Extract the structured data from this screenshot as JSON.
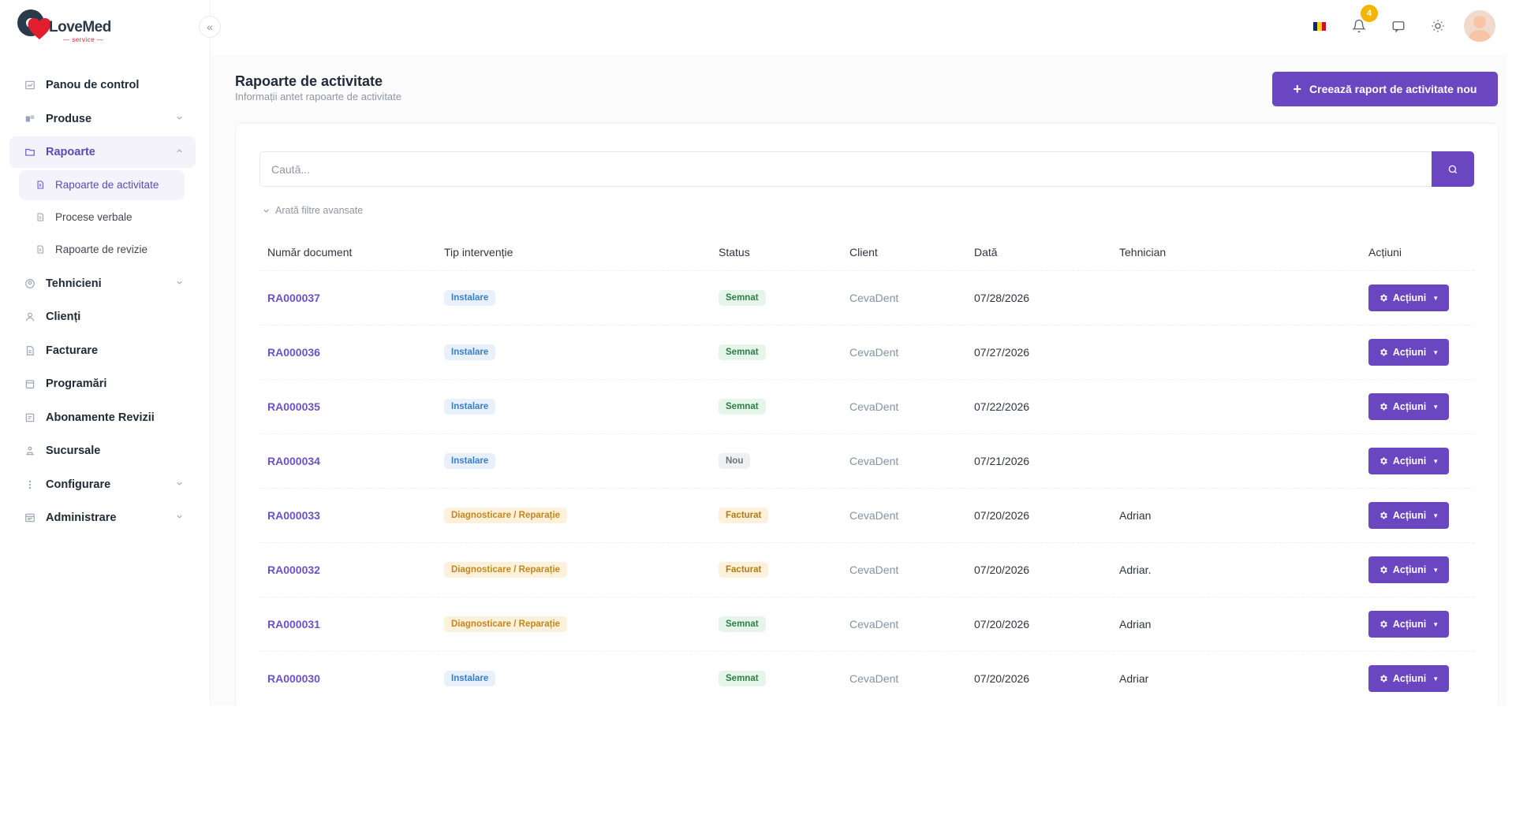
{
  "brand": {
    "name": "LoveMed",
    "sub": "— service —"
  },
  "sidebar": {
    "items": [
      {
        "label": "Panou de control",
        "icon": "dashboard-icon",
        "has_chevron": false
      },
      {
        "label": "Produse",
        "icon": "products-icon",
        "has_chevron": true
      },
      {
        "label": "Rapoarte",
        "icon": "reports-icon",
        "has_chevron": true,
        "expanded": true
      },
      {
        "label": "Tehnicieni",
        "icon": "technicians-icon",
        "has_chevron": true
      },
      {
        "label": "Clienți",
        "icon": "clients-icon",
        "has_chevron": false
      },
      {
        "label": "Facturare",
        "icon": "invoice-icon",
        "has_chevron": false
      },
      {
        "label": "Programări",
        "icon": "calendar-icon",
        "has_chevron": false
      },
      {
        "label": "Abonamente Revizii",
        "icon": "subscription-icon",
        "has_chevron": false
      },
      {
        "label": "Sucursale",
        "icon": "branch-icon",
        "has_chevron": false
      },
      {
        "label": "Configurare",
        "icon": "more-vertical-icon",
        "has_chevron": true
      },
      {
        "label": "Administrare",
        "icon": "admin-icon",
        "has_chevron": true
      }
    ],
    "report_sub": [
      {
        "label": "Rapoarte de activitate",
        "active": true
      },
      {
        "label": "Procese verbale",
        "active": false
      },
      {
        "label": "Rapoarte de revizie",
        "active": false
      }
    ]
  },
  "header": {
    "notification_count": "4",
    "language_flag": "romania-flag-icon",
    "flag_colors": [
      "#002b7f",
      "#fcd116",
      "#ce1126"
    ]
  },
  "page": {
    "title": "Rapoarte de activitate",
    "subtitle": "Informații antet rapoarte de activitate",
    "create_button": "Creează raport de activitate nou",
    "search_placeholder": "Caută...",
    "advanced_filters": "Arată filtre avansate"
  },
  "table": {
    "columns": [
      "Număr document",
      "Tip intervenție",
      "Status",
      "Client",
      "Dată",
      "Tehnician",
      "Acțiuni"
    ],
    "action_label": "Acțiuni",
    "rows": [
      {
        "doc": "RA000037",
        "type": "Instalare",
        "status": "Semnat",
        "client": "CevaDent",
        "date": "07/28/2026",
        "tech": ""
      },
      {
        "doc": "RA000036",
        "type": "Instalare",
        "status": "Semnat",
        "client": "CevaDent",
        "date": "07/27/2026",
        "tech": ""
      },
      {
        "doc": "RA000035",
        "type": "Instalare",
        "status": "Semnat",
        "client": "CevaDent",
        "date": "07/22/2026",
        "tech": ""
      },
      {
        "doc": "RA000034",
        "type": "Instalare",
        "status": "Nou",
        "client": "CevaDent",
        "date": "07/21/2026",
        "tech": ""
      },
      {
        "doc": "RA000033",
        "type": "Diagnosticare / Reparație",
        "status": "Facturat",
        "client": "CevaDent",
        "date": "07/20/2026",
        "tech": "Adrian"
      },
      {
        "doc": "RA000032",
        "type": "Diagnosticare / Reparație",
        "status": "Facturat",
        "client": "CevaDent",
        "date": "07/20/2026",
        "tech": "Adriar."
      },
      {
        "doc": "RA000031",
        "type": "Diagnosticare / Reparație",
        "status": "Semnat",
        "client": "CevaDent",
        "date": "07/20/2026",
        "tech": "Adrian"
      },
      {
        "doc": "RA000030",
        "type": "Instalare",
        "status": "Semnat",
        "client": "CevaDent",
        "date": "07/20/2026",
        "tech": "Adriar"
      }
    ]
  },
  "colors": {
    "primary": "#6b46c1",
    "type_instalare_bg": "#e8f1fb",
    "type_instalare_fg": "#3b7ec6",
    "type_diag_bg": "#fdf1dc",
    "type_diag_fg": "#c4871b",
    "status_semnat_bg": "#e5f5ea",
    "status_semnat_fg": "#2f7d47",
    "status_nou_bg": "#eef0f2",
    "status_nou_fg": "#6a737d",
    "status_facturat_bg": "#fdf1dc",
    "status_facturat_fg": "#b47a12"
  }
}
